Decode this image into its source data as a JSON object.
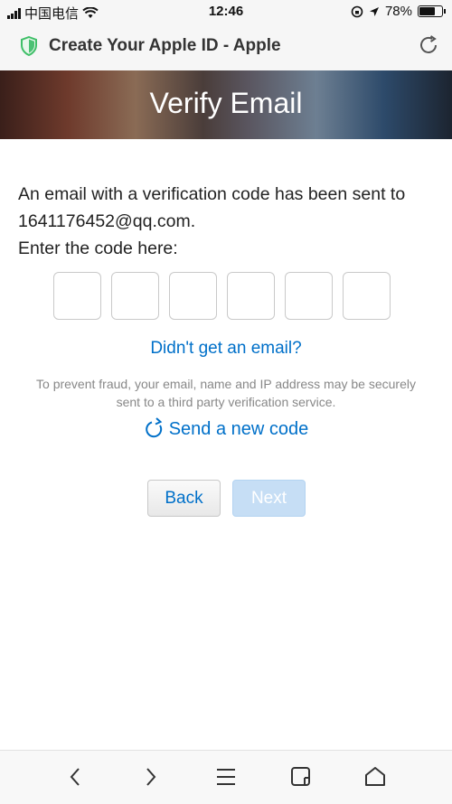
{
  "status_bar": {
    "carrier": "中国电信",
    "time": "12:46",
    "battery_percent": "78%",
    "battery_level": 0.78
  },
  "address_bar": {
    "page_title": "Create Your Apple ID - Apple"
  },
  "hero": {
    "title": "Verify Email"
  },
  "main": {
    "message_line1": "An email with a verification code has been sent to",
    "email": "1641176452@qq.com.",
    "prompt": "Enter the code here:",
    "code_digits": [
      "",
      "",
      "",
      "",
      "",
      ""
    ],
    "didnt_get_link": "Didn't get an email?",
    "fraud_note_line1": "To prevent fraud, your email, name and IP address may be securely",
    "fraud_note_line2": "sent to a third party verification service.",
    "resend_link": "Send a new code"
  },
  "actions": {
    "back_label": "Back",
    "next_label": "Next"
  },
  "colors": {
    "link": "#0070c9",
    "next_disabled": "#c6def5"
  }
}
